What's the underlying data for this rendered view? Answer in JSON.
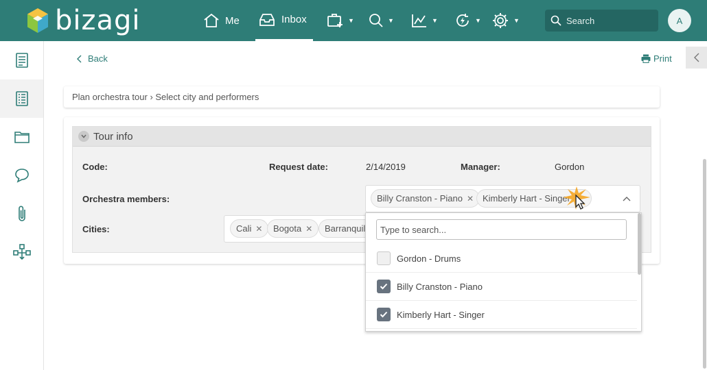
{
  "header": {
    "brand": "bizagi",
    "nav": {
      "me_label": "Me",
      "inbox_label": "Inbox"
    },
    "search": {
      "placeholder": "Search"
    },
    "avatar_initial": "A"
  },
  "sidebar": {
    "items": [
      {
        "icon": "form-icon"
      },
      {
        "icon": "case-list-icon"
      },
      {
        "icon": "folder-icon"
      },
      {
        "icon": "comments-icon"
      },
      {
        "icon": "attachment-icon"
      },
      {
        "icon": "process-flow-icon"
      }
    ],
    "active_index": 1
  },
  "toolbar": {
    "back_label": "Back",
    "print_label": "Print"
  },
  "breadcrumb": "Plan orchestra tour › Select city and performers",
  "tour_info": {
    "title": "Tour info",
    "code_label": "Code:",
    "request_date_label": "Request date:",
    "request_date_value": "2/14/2019",
    "manager_label": "Manager:",
    "manager_value": "Gordon",
    "members_label": "Orchestra members:",
    "members_selected": [
      {
        "label": "Billy Cranston - Piano"
      },
      {
        "label": "Kimberly Hart - Singer"
      }
    ],
    "cities_label": "Cities:",
    "cities_selected": [
      {
        "label": "Cali"
      },
      {
        "label": "Bogota"
      },
      {
        "label": "Barranquil"
      }
    ]
  },
  "members_dropdown": {
    "search_placeholder": "Type to search...",
    "options": [
      {
        "label": "Gordon - Drums",
        "checked": false
      },
      {
        "label": "Billy Cranston - Piano",
        "checked": true
      },
      {
        "label": "Kimberly Hart - Singer",
        "checked": true
      }
    ]
  },
  "colors": {
    "brand": "#2e7d77",
    "checkbox_checked": "#68737f",
    "cursor_highlight": "#f5a623"
  }
}
